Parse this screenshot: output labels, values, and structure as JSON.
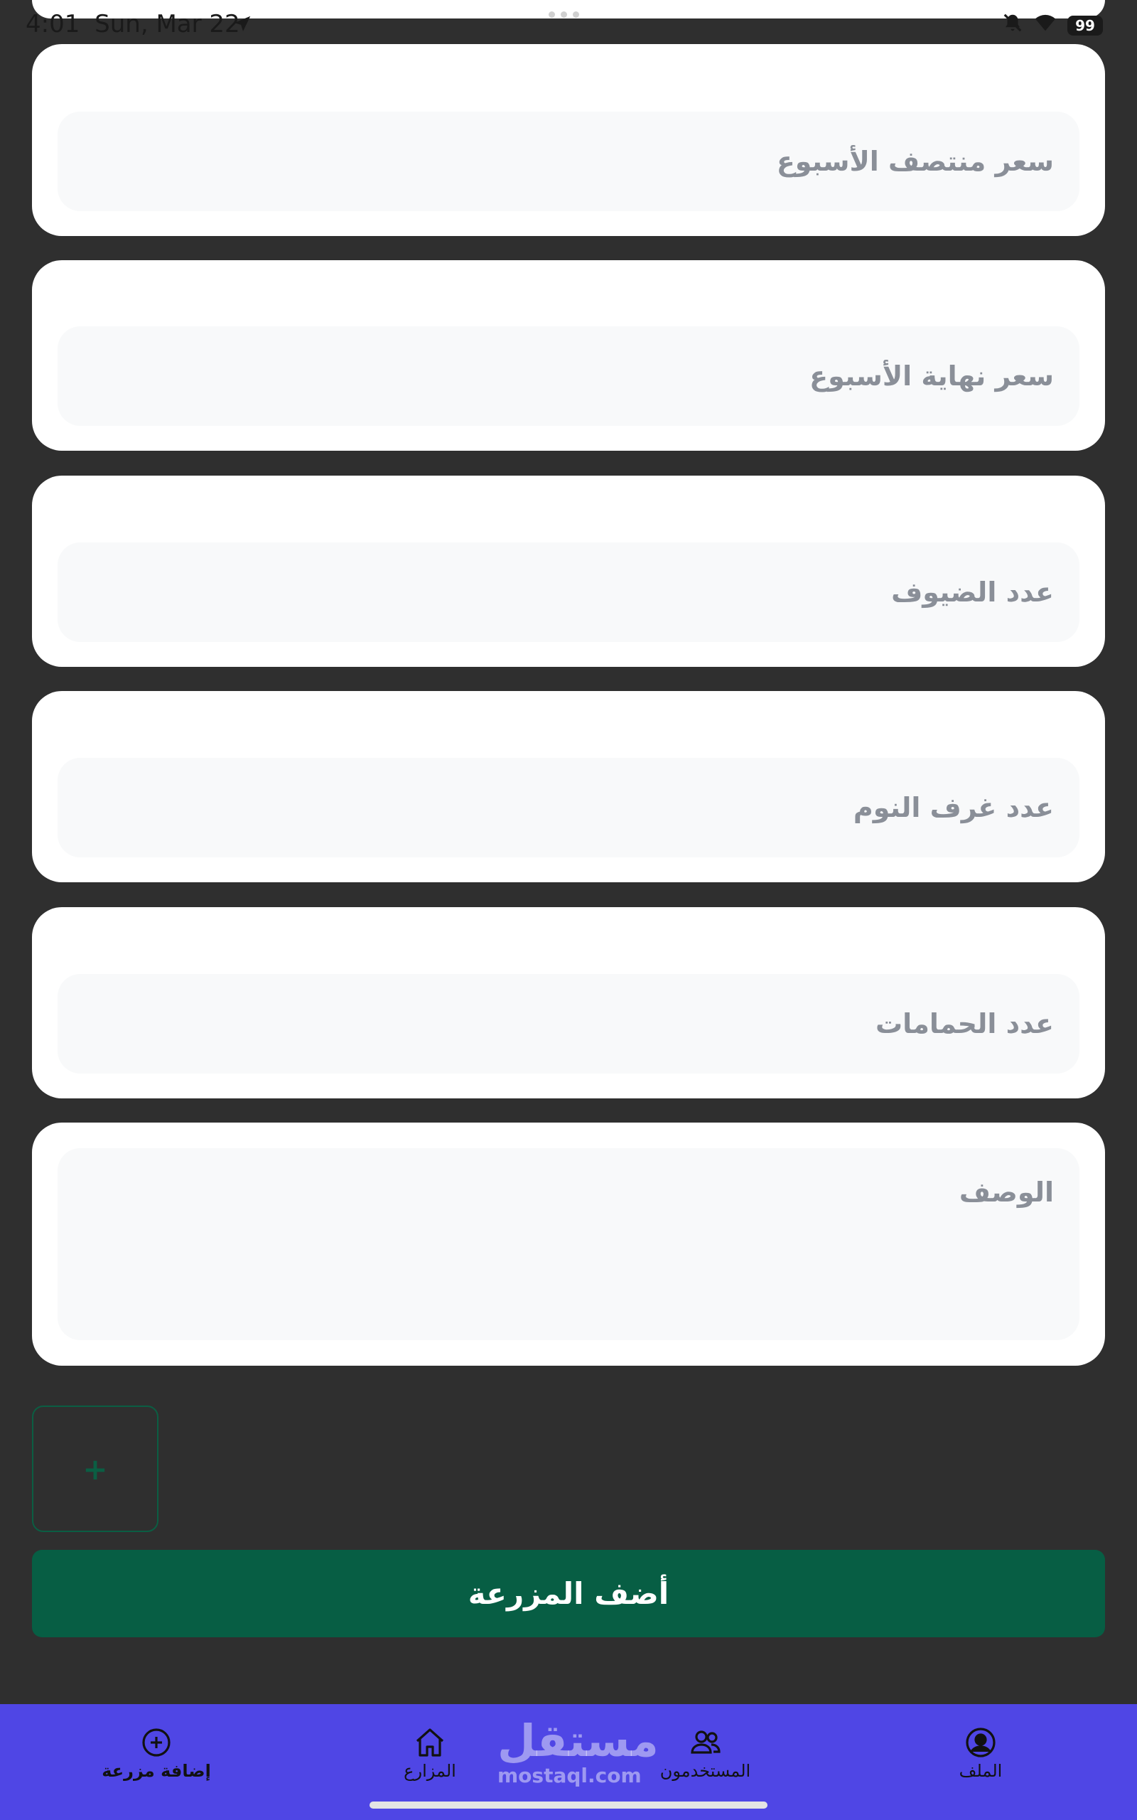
{
  "status_bar": {
    "time": "4:01",
    "date": "Sun, Mar 22",
    "battery": "99"
  },
  "form": {
    "fields": [
      {
        "placeholder": "سعر منتصف الأسبوع"
      },
      {
        "placeholder": "سعر نهاية الأسبوع"
      },
      {
        "placeholder": "عدد الضيوف"
      },
      {
        "placeholder": "عدد غرف النوم"
      },
      {
        "placeholder": "عدد الحمامات"
      },
      {
        "placeholder": "الوصف"
      }
    ],
    "add_image_label": "+",
    "submit_label": "أضف المزرعة"
  },
  "bottom_nav": {
    "items": [
      {
        "label": "إضافة مزرعة",
        "icon": "plus-circle-icon",
        "active": true
      },
      {
        "label": "المزارع",
        "icon": "home-icon",
        "active": false
      },
      {
        "label": "المستخدمون",
        "icon": "users-icon",
        "active": false
      },
      {
        "label": "الملف",
        "icon": "user-circle-icon",
        "active": false
      }
    ],
    "watermark_ar": "مستقل",
    "watermark_en": "mostaql.com"
  },
  "colors": {
    "background": "#2f2f2f",
    "card": "#ffffff",
    "field": "#f8f9fa",
    "accent": "#075e44",
    "nav": "#4f46e5"
  }
}
